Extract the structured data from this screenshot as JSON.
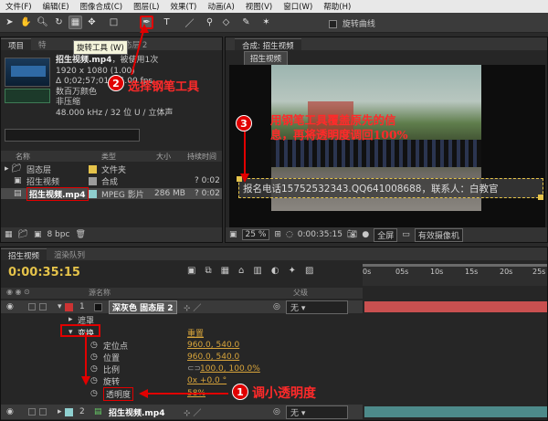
{
  "menu": [
    "文件(F)",
    "编辑(E)",
    "图像合成(C)",
    "图层(L)",
    "效果(T)",
    "动画(A)",
    "视图(V)",
    "窗口(W)",
    "帮助(H)"
  ],
  "toolbar": {
    "rotobrush_label": "旋转曲线",
    "tooltip": "旋转工具 (W)"
  },
  "project": {
    "tab_label": "项目",
    "tab2_label": "特",
    "tab3_label": "色 固态层 2",
    "asset_name": "招生视频.mp4",
    "usage": "，被使用1次",
    "details": [
      "1920 x 1080 (1.00)",
      "Δ 0;02;57;01, 25.00 fps",
      "数百万颜色",
      "非压缩",
      "48.000 kHz / 32 位 U / 立体声"
    ],
    "columns": {
      "name": "名称",
      "type": "类型",
      "size": "大小",
      "duration": "持续时间"
    },
    "items": [
      {
        "name": "固态层",
        "type": "文件夹",
        "size": "",
        "duration": ""
      },
      {
        "name": "招生视频",
        "type": "合成",
        "size": "",
        "duration": "? 0:02"
      },
      {
        "name": "招生视频.mp4",
        "type": "MPEG 影片",
        "size": "286 MB",
        "duration": "? 0:02"
      }
    ],
    "bpc": "8 bpc"
  },
  "comp": {
    "header": "合成: 招生视频",
    "breadcrumb": "招生视频",
    "overlay_text": "报名电话15752532343.QQ641008688，联系人：白教官",
    "zoom": "25 %",
    "timecode": "0:00:35:15",
    "resolution": "全屏",
    "camera": "有效摄像机"
  },
  "annotations": {
    "a1": "调小透明度",
    "a2": "选择钢笔工具",
    "a3_line1": "用钢笔工具覆盖原先的信",
    "a3_line2": "息，再将透明度调回100%",
    "n1": "1",
    "n2": "2",
    "n3": "3"
  },
  "timeline": {
    "tab1": "招生视频",
    "tab2": "渲染队列",
    "timecode": "0:00:35:15",
    "col_layer_name": "源名称",
    "col_parent": "父级",
    "ruler": [
      "0s",
      "05s",
      "10s",
      "15s",
      "20s",
      "25s"
    ],
    "layer1": {
      "num": "1",
      "name": "深灰色 固态层 2",
      "parent": "无"
    },
    "mask_label": "遮罩",
    "transform_label": "变换",
    "reset_label": "重置",
    "props": [
      {
        "name": "定位点",
        "value": "960.0, 540.0"
      },
      {
        "name": "位置",
        "value": "960.0, 540.0"
      },
      {
        "name": "比例",
        "value": "100.0, 100.0%"
      },
      {
        "name": "旋转",
        "value": "0x +0.0 °"
      },
      {
        "name": "透明度",
        "value": "58%"
      }
    ],
    "layer2": {
      "num": "2",
      "name": "招生视频.mp4",
      "parent": "无"
    }
  },
  "colors": {
    "accent": "#e10000",
    "value": "#d9a53b",
    "layer_bar": "#c95050"
  }
}
